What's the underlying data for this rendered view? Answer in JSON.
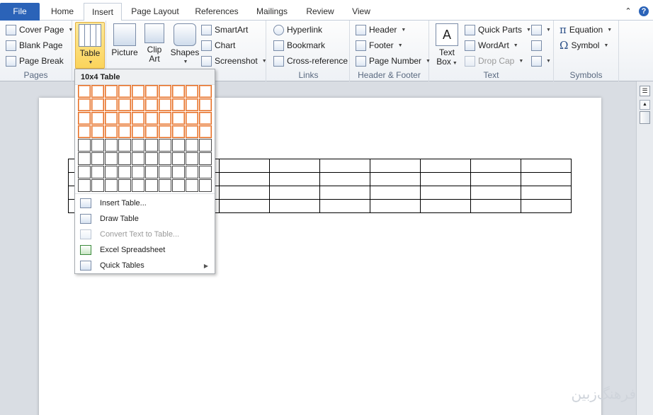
{
  "tabs": {
    "file": "File",
    "home": "Home",
    "insert": "Insert",
    "page_layout": "Page Layout",
    "references": "References",
    "mailings": "Mailings",
    "review": "Review",
    "view": "View"
  },
  "ribbon": {
    "pages": {
      "label": "Pages",
      "cover_page": "Cover Page",
      "blank_page": "Blank Page",
      "page_break": "Page Break"
    },
    "tables": {
      "table": "Table"
    },
    "illustrations": {
      "picture": "Picture",
      "clip_art_1": "Clip",
      "clip_art_2": "Art",
      "shapes": "Shapes",
      "smartart": "SmartArt",
      "chart": "Chart",
      "screenshot": "Screenshot"
    },
    "links": {
      "label": "Links",
      "hyperlink": "Hyperlink",
      "bookmark": "Bookmark",
      "cross_reference": "Cross-reference"
    },
    "header_footer": {
      "label": "Header & Footer",
      "header": "Header",
      "footer": "Footer",
      "page_number": "Page Number"
    },
    "text": {
      "label": "Text",
      "text_box_1": "Text",
      "text_box_2": "Box",
      "quick_parts": "Quick Parts",
      "wordart": "WordArt",
      "drop_cap": "Drop Cap"
    },
    "symbols": {
      "label": "Symbols",
      "equation": "Equation",
      "symbol": "Symbol"
    }
  },
  "table_dropdown": {
    "header": "10x4 Table",
    "grid_cols": 10,
    "grid_rows": 8,
    "selected_cols": 10,
    "selected_rows": 4,
    "items": {
      "insert_table": "Insert Table...",
      "draw_table": "Draw Table",
      "convert_text": "Convert Text to Table...",
      "excel_spreadsheet": "Excel Spreadsheet",
      "quick_tables": "Quick Tables"
    }
  },
  "document": {
    "table_rows": 4,
    "table_cols": 10
  },
  "watermark": "فرهنگ‌زبین",
  "colors": {
    "file_tab": "#2b63b8",
    "grid_selected": "#e36a1f",
    "table_button_active": "#fbd45c"
  }
}
